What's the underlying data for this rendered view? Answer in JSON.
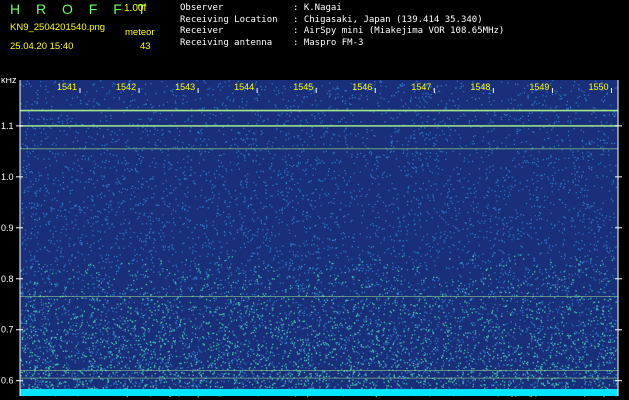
{
  "header": {
    "title": "H R O F F T",
    "version": "1.00f",
    "filename": "KN9_2504201540.png",
    "meteor_label": "meteor",
    "datetime": "25.04.20 15:40",
    "meteor_count": "43",
    "info": [
      {
        "key": "Observer",
        "value": ": K.Nagai"
      },
      {
        "key": "Receiving Location",
        "value": ": Chigasaki, Japan (139.414 35.340)"
      },
      {
        "key": "Receiver",
        "value": ": AirSpy mini (Miakejima VOR 108.65MHz)"
      },
      {
        "key": "Receiving antenna",
        "value": ": Maspro FM-3"
      }
    ]
  },
  "chart_data": {
    "type": "heatmap",
    "ylabel": "kHz",
    "x_ticks": [
      "1541",
      "1542",
      "1543",
      "1544",
      "1545",
      "1546",
      "1547",
      "1548",
      "1549",
      "1550"
    ],
    "y_ticks": [
      "1.1",
      "1.0",
      "0.9",
      "0.8",
      "0.7",
      "0.6"
    ],
    "y_tick_values": [
      1.1,
      1.0,
      0.9,
      0.8,
      0.7,
      0.6
    ],
    "ylim": [
      0.57,
      1.19
    ],
    "horizontal_lines_khz": [
      1.13,
      1.1,
      1.055,
      0.765,
      0.62,
      0.605
    ],
    "colors": {
      "background": "#1a2f7a",
      "noise": "#2f7fd0",
      "signal": "#46d6b0",
      "line": "#9fe88a",
      "axis": "#ffffff",
      "label": "#ffff00",
      "bottom_band": "#00e5ff"
    }
  }
}
